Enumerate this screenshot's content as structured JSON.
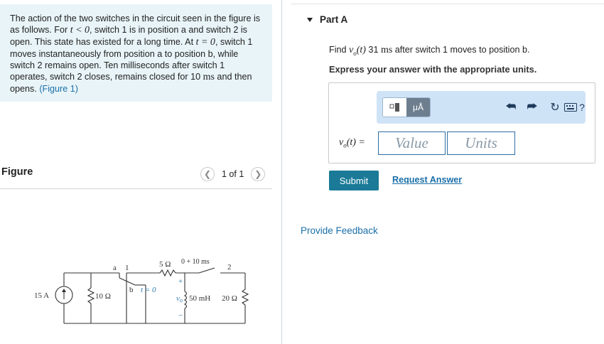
{
  "problem": {
    "text_a": "The action of the two switches in the circuit seen in the figure is as follows. For ",
    "t_lt_0": "t < 0",
    "text_b": ", switch 1 is in position a and switch 2 is open. This state has existed for a long time. At ",
    "t_eq_0": "t = 0",
    "text_c": ", switch 1 moves instantaneously from position a to position b, while switch 2 remains open. Ten milliseconds after switch 1 operates, switch 2 closes, remains closed for 10 ",
    "ms": "ms",
    "text_d": " and then opens. ",
    "figure_link": "(Figure 1)"
  },
  "figure": {
    "label": "Figure",
    "pager": "1 of 1",
    "prev_icon": "chevron-left-icon",
    "next_icon": "chevron-right-icon",
    "circuit": {
      "source": "15 A",
      "r1": "10 Ω",
      "r2": "5 Ω",
      "sw1_a": "a",
      "sw1_num": "1",
      "sw1_b": "b",
      "t0": "t = 0",
      "sw2_time": "0 + 10 ms",
      "sw2_num": "2",
      "plus": "+",
      "minus": "−",
      "vo": "v",
      "vo_sub": "o",
      "inductor": "50 mH",
      "r3": "20 Ω"
    }
  },
  "part": {
    "title": "Part A",
    "find_a": "Find ",
    "find_var": "v",
    "find_sub": "o",
    "find_paren": "(t)",
    "find_b": " 31 ",
    "find_ms": "ms",
    "find_c": " after switch 1 moves to position b.",
    "express": "Express your answer with the appropriate units.",
    "toolbar": {
      "templates_icon": "templates-icon",
      "units_label": "μÅ",
      "undo_icon": "undo-icon",
      "redo_icon": "redo-icon",
      "reset_icon": "reset-icon",
      "keyboard_icon": "keyboard-icon",
      "help_label": "?"
    },
    "eq_var": "v",
    "eq_sub": "o",
    "eq_rest": "(t) =",
    "value_placeholder": "Value",
    "units_placeholder": "Units",
    "submit": "Submit",
    "request": "Request Answer"
  },
  "feedback": "Provide Feedback",
  "colors": {
    "problem_bg": "#e8f4f8",
    "link": "#1a6fa8",
    "submit_bg": "#1a7a97",
    "toolbar_bg": "#cfe3f7"
  }
}
